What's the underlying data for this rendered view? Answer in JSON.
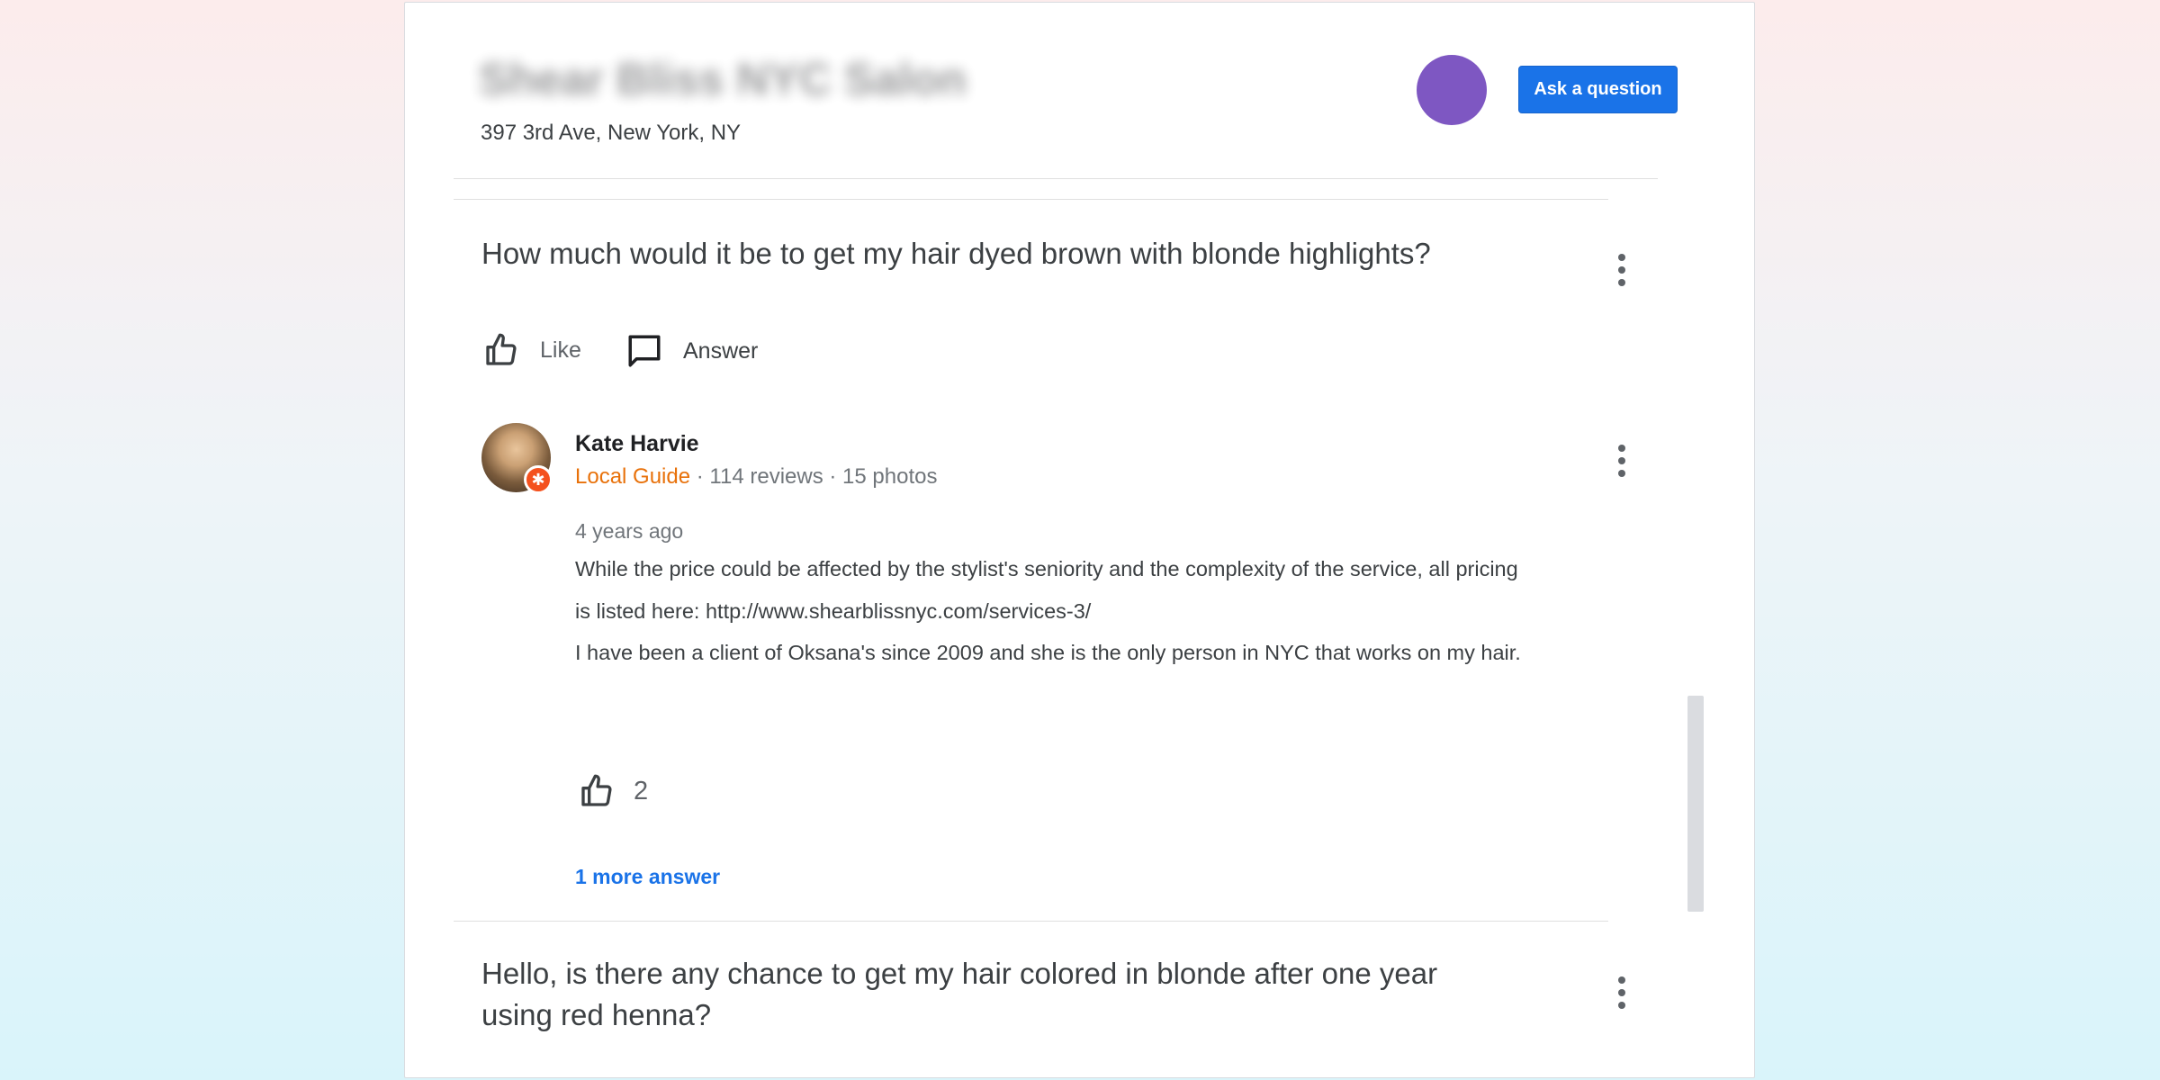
{
  "header": {
    "business_name": "Shear Bliss NYC Salon",
    "address": "397 3rd Ave, New York, NY",
    "ask_button_label": "Ask a question",
    "avatar_color": "#7e57c2"
  },
  "questions": [
    {
      "text": "How much would it be to get my hair dyed brown with blonde highlights?",
      "actions": {
        "like_label": "Like",
        "answer_label": "Answer"
      },
      "answer": {
        "author": "Kate Harvie",
        "badge": "Local Guide",
        "stats": "· 114 reviews · 15 photos",
        "date": "4 years ago",
        "paragraphs": [
          "While the price could be affected by the stylist's seniority and the complexity of the service, all pricing is listed here: http://www.shearblissnyc.com/services-3/",
          "I have been a client of Oksana's since 2009 and she is the only person in NYC that works on my hair."
        ],
        "like_count": "2"
      },
      "more_answers_label": "1 more answer"
    },
    {
      "text_lines": [
        "Hello, is there any chance to get my hair colored in blonde after one year",
        "using red henna?"
      ]
    }
  ],
  "colors": {
    "primary_button": "#1a73e8",
    "local_guide": "#e8710a",
    "link": "#1a73e8"
  }
}
